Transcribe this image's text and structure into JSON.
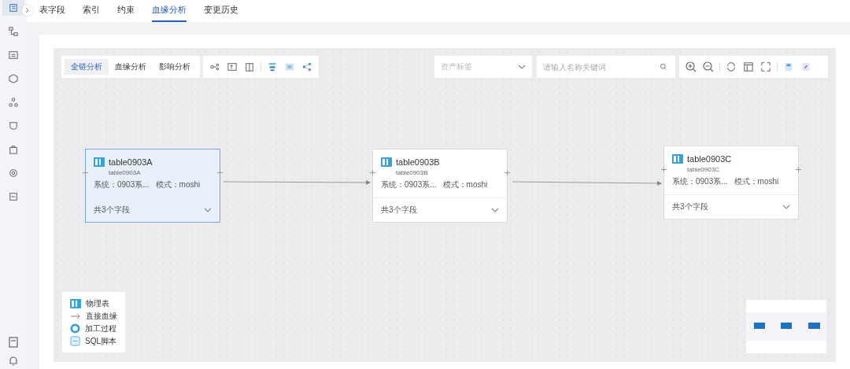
{
  "sidebar": [
    {
      "selected": true
    },
    {
      "selected": false
    },
    {
      "selected": false
    },
    {
      "selected": false
    },
    {
      "selected": false
    },
    {
      "selected": false
    },
    {
      "selected": false
    },
    {
      "selected": false
    },
    {
      "selected": false
    }
  ],
  "tabs": [
    {
      "label": "表字段",
      "selected": false
    },
    {
      "label": "索引",
      "selected": false
    },
    {
      "label": "约束",
      "selected": false
    },
    {
      "label": "血缘分析",
      "selected": true
    },
    {
      "label": "变更历史",
      "selected": false
    }
  ],
  "analysis_modes": [
    {
      "label": "全链分析",
      "selected": true
    },
    {
      "label": "血缘分析",
      "selected": false
    },
    {
      "label": "影响分析",
      "selected": false
    }
  ],
  "asset_tag": {
    "placeholder": "资产标签"
  },
  "search": {
    "placeholder": "请输入名称关键词"
  },
  "nodes": [
    {
      "title": "table0903A",
      "subtitle": "table0903A",
      "system": "系统：0903系...",
      "schema": "模式：moshi",
      "field_count": "共3个字段",
      "selected": true
    },
    {
      "title": "table0903B",
      "subtitle": "table0903B",
      "system": "系统：0903系...",
      "schema": "模式：moshi",
      "field_count": "共3个字段",
      "selected": false
    },
    {
      "title": "table0903C",
      "subtitle": "table0903C",
      "system": "系统：0903系...",
      "schema": "模式：moshi",
      "field_count": "共3个字段",
      "selected": false
    }
  ],
  "legend": [
    {
      "kind": "table",
      "label": "物理表"
    },
    {
      "kind": "arrow",
      "label": "直接血缘"
    },
    {
      "kind": "process",
      "label": "加工过程"
    },
    {
      "kind": "sql",
      "label": "SQL脚本"
    }
  ]
}
